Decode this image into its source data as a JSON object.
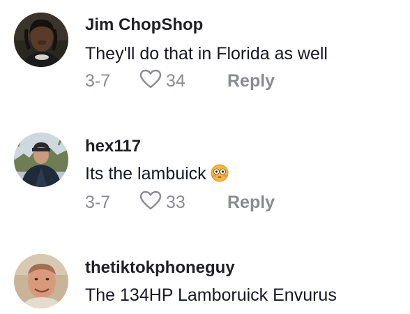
{
  "comments": [
    {
      "username": "Jim ChopShop",
      "text": "They'll do that in Florida as well",
      "date": "3-7",
      "likes": "34",
      "reply_label": "Reply",
      "avatar_icon": "avatar-photo"
    },
    {
      "username": "hex117",
      "text": "Its the lambuick",
      "emoji_icon": "flushed-face-icon",
      "date": "3-7",
      "likes": "33",
      "reply_label": "Reply",
      "avatar_icon": "avatar-photo"
    },
    {
      "username": "thetiktokphoneguy",
      "text": "The 134HP Lamboruick Envurus",
      "avatar_icon": "avatar-photo"
    }
  ],
  "colors": {
    "username": "#1f1f24",
    "text": "#161823",
    "meta": "#8a8b91"
  }
}
